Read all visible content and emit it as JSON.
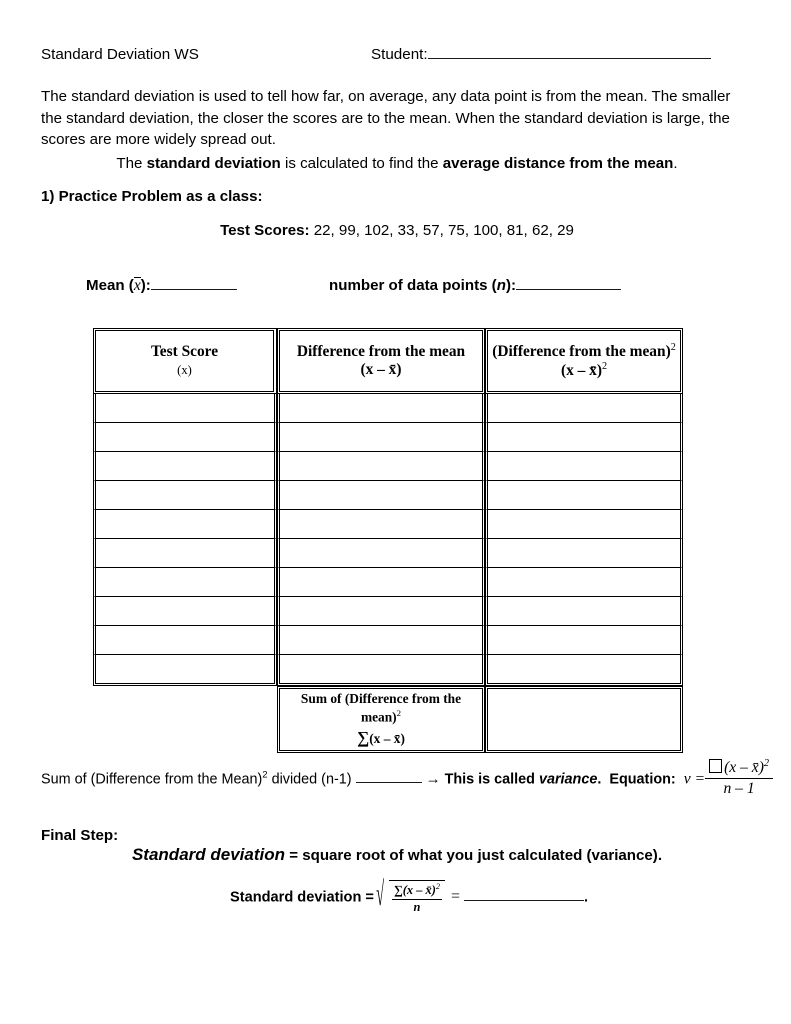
{
  "header": {
    "title": "Standard Deviation WS",
    "student_label": "Student:",
    "student_value": ""
  },
  "intro": {
    "paragraph": "The standard deviation is used to tell how far, on average, any data point is from the mean.  The smaller the standard deviation, the closer the scores are to the mean.  When the standard deviation is large, the scores are more widely spread out."
  },
  "statement": {
    "part1": "The ",
    "bold1": "standard deviation",
    "part2": " is calculated to find the ",
    "bold2": "average distance from the mean",
    "part3": "."
  },
  "practice": {
    "heading": "1) Practice Problem as a class:",
    "scores_label": "Test Scores:",
    "scores_values": "22, 99, 102, 33, 57, 75, 100, 81, 62, 29"
  },
  "mean_line": {
    "mean_label_pre": "Mean (",
    "mean_symbol": "x",
    "mean_label_post": "):",
    "mean_value": "",
    "n_label_pre": "number of data points (",
    "n_symbol": "n",
    "n_label_post": "):",
    "n_value": ""
  },
  "table": {
    "columns": [
      {
        "title": "Test Score",
        "symbol": "(x)"
      },
      {
        "title": "Difference from the mean",
        "symbol": "(x – x̄)"
      },
      {
        "title": "(Difference from the mean)",
        "title_sup": "2",
        "symbol": "(x – x̄)",
        "symbol_sup": "2"
      }
    ],
    "row_count": 10,
    "rows": [
      {
        "score": "",
        "difference": "",
        "difference_squared": ""
      },
      {
        "score": "",
        "difference": "",
        "difference_squared": ""
      },
      {
        "score": "",
        "difference": "",
        "difference_squared": ""
      },
      {
        "score": "",
        "difference": "",
        "difference_squared": ""
      },
      {
        "score": "",
        "difference": "",
        "difference_squared": ""
      },
      {
        "score": "",
        "difference": "",
        "difference_squared": ""
      },
      {
        "score": "",
        "difference": "",
        "difference_squared": ""
      },
      {
        "score": "",
        "difference": "",
        "difference_squared": ""
      },
      {
        "score": "",
        "difference": "",
        "difference_squared": ""
      },
      {
        "score": "",
        "difference": "",
        "difference_squared": ""
      }
    ],
    "sum_row": {
      "label": "Sum of (Difference from the mean)",
      "label_sup": "2",
      "sigma_symbol": "∑",
      "sigma_expr": "(x – x̄)",
      "value": ""
    }
  },
  "variance": {
    "text_pre": "Sum of (Difference from the Mean)",
    "text_sup": "2",
    "text_mid": " divided (n-1)",
    "blank_value": "",
    "arrow": "→",
    "text_post": "This is called ",
    "emphasis": "variance",
    "text_end": ".",
    "equation_label": "Equation:",
    "equation": {
      "lhs": "v =",
      "numerator_box": "□",
      "numerator": "(x – x̄)",
      "numerator_sup": "2",
      "denominator": "n – 1"
    }
  },
  "final_step": {
    "heading": "Final Step:",
    "sentence_emphasis": "Standard deviation",
    "sentence_rest": " = square root of what you just calculated (variance).",
    "formula_label": "Standard deviation =",
    "formula": {
      "numerator_sigma": "∑",
      "numerator": "(x – x̄)",
      "numerator_sup": "2",
      "denominator": "n",
      "equals": "=",
      "result_value": "",
      "period": "."
    }
  }
}
